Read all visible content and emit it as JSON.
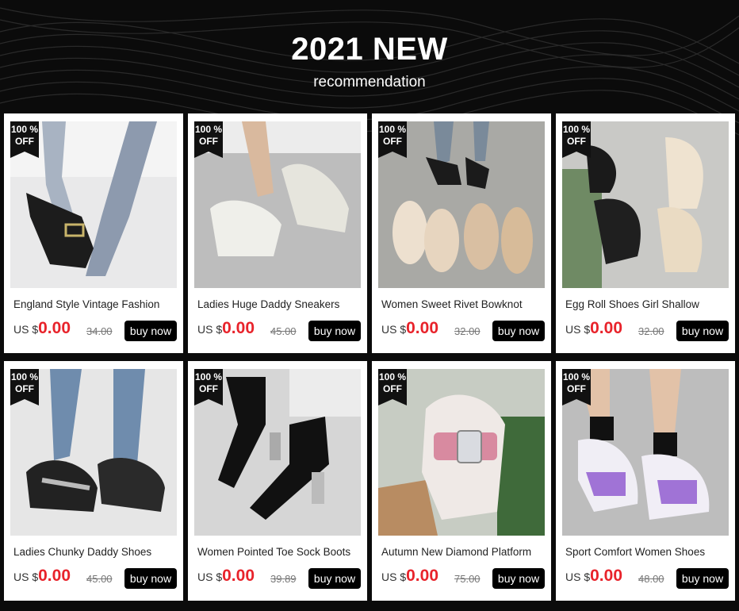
{
  "header": {
    "title": "2021 NEW",
    "subtitle": "recommendation"
  },
  "colors": {
    "price": "#e8232b",
    "button": "#000000",
    "background": "#0b0b0b"
  },
  "products": [
    {
      "badge_top": "100 %",
      "badge_bottom": "OFF",
      "title": "England Style Vintage Fashion",
      "currency": "US $",
      "price": "0.00",
      "old_price": "34.00",
      "button": "buy now"
    },
    {
      "badge_top": "100 %",
      "badge_bottom": "OFF",
      "title": "Ladies Huge Daddy Sneakers",
      "currency": "US $",
      "price": "0.00",
      "old_price": "45.00",
      "button": "buy now"
    },
    {
      "badge_top": "100 %",
      "badge_bottom": "OFF",
      "title": "Women Sweet Rivet Bowknot",
      "currency": "US $",
      "price": "0.00",
      "old_price": "32.00",
      "button": "buy now"
    },
    {
      "badge_top": "100 %",
      "badge_bottom": "OFF",
      "title": "Egg Roll Shoes Girl Shallow",
      "currency": "US $",
      "price": "0.00",
      "old_price": "32.00",
      "button": "buy now"
    },
    {
      "badge_top": "100 %",
      "badge_bottom": "OFF",
      "title": "Ladies Chunky Daddy Shoes",
      "currency": "US $",
      "price": "0.00",
      "old_price": "45.00",
      "button": "buy now"
    },
    {
      "badge_top": "100 %",
      "badge_bottom": "OFF",
      "title": "Women Pointed Toe Sock Boots",
      "currency": "US $",
      "price": "0.00",
      "old_price": "39.89",
      "button": "buy now"
    },
    {
      "badge_top": "100 %",
      "badge_bottom": "OFF",
      "title": "Autumn New Diamond Platform",
      "currency": "US $",
      "price": "0.00",
      "old_price": "75.00",
      "button": "buy now"
    },
    {
      "badge_top": "100 %",
      "badge_bottom": "OFF",
      "title": "Sport Comfort Women Shoes",
      "currency": "US $",
      "price": "0.00",
      "old_price": "48.00",
      "button": "buy now"
    }
  ]
}
